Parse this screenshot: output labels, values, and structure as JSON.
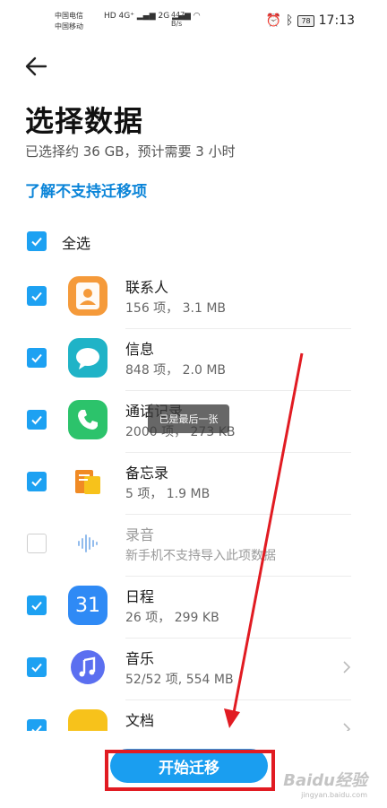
{
  "status_bar": {
    "carrier1": "中国电信",
    "carrier2": "中国移动",
    "net1": "HD 4G⁺",
    "net2": "2G",
    "speed_value": "447",
    "speed_unit": "B/s",
    "battery": "78",
    "time": "17:13"
  },
  "header": {
    "title": "选择数据",
    "subtitle": "已选择约 36 GB，预计需要 3 小时",
    "unsupported_link": "了解不支持迁移项"
  },
  "select_all": {
    "label": "全选",
    "checked": true
  },
  "items": [
    {
      "name": "联系人",
      "detail": "156 项， 3.1 MB",
      "icon": "contacts-icon",
      "icon_color": "#f59a3a",
      "checked": true
    },
    {
      "name": "信息",
      "detail": "848 项， 2.0 MB",
      "icon": "messages-icon",
      "icon_color": "#1fb3c7",
      "checked": true
    },
    {
      "name": "通话记录",
      "detail": "2000 项， 273 KB",
      "icon": "phone-icon",
      "icon_color": "#2cc36b",
      "checked": true
    },
    {
      "name": "备忘录",
      "detail": "5 项， 1.9 MB",
      "icon": "notes-icon",
      "icon_color": "#f5a623",
      "checked": true
    },
    {
      "name": "录音",
      "detail": "新手机不支持导入此项数据",
      "icon": "recorder-icon",
      "icon_color": "#4a90e2",
      "checked": false
    },
    {
      "name": "日程",
      "detail": "26 项， 299 KB",
      "icon": "calendar-icon",
      "icon_color": "#2f8af5",
      "icon_text": "31",
      "checked": true
    },
    {
      "name": "音乐",
      "detail": "52/52 项, 554 MB",
      "icon": "music-icon",
      "icon_color": "#5b6ff0",
      "checked": true
    },
    {
      "name": "文档",
      "detail": "",
      "icon": "documents-icon",
      "icon_color": "#f7c21b",
      "checked": true
    }
  ],
  "toast": "已是最后一张",
  "start_button": "开始迁移",
  "watermark": {
    "brand": "Baidu经验",
    "url": "jingyan.baidu.com"
  },
  "colors": {
    "accent": "#1a9ef0",
    "annotation": "#e11b22"
  }
}
